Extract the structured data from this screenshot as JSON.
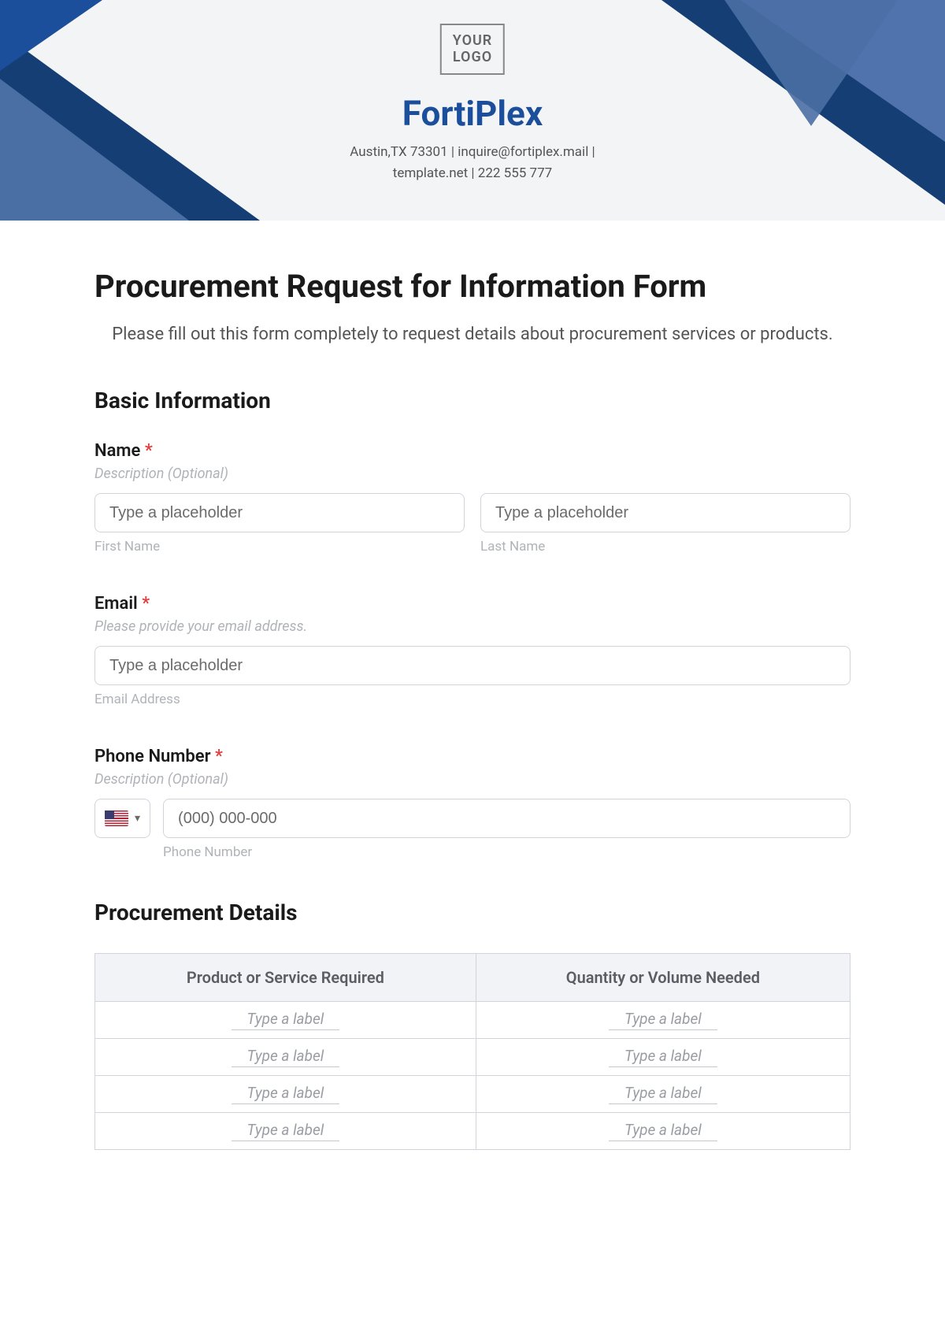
{
  "header": {
    "logo_text_line1": "YOUR",
    "logo_text_line2": "LOGO",
    "company_name": "FortiPlex",
    "info_line1": "Austin,TX 73301 | inquire@fortiplex.mail |",
    "info_line2": "template.net | 222 555 777"
  },
  "page": {
    "title": "Procurement Request for Information Form",
    "intro": "Please fill out this form completely to request details about procurement services or products."
  },
  "sections": {
    "basic_info_heading": "Basic Information",
    "procurement_details_heading": "Procurement Details"
  },
  "fields": {
    "name": {
      "label": "Name",
      "required_mark": "*",
      "description": "Description (Optional)",
      "first_placeholder": "Type a placeholder",
      "first_sublabel": "First Name",
      "last_placeholder": "Type a placeholder",
      "last_sublabel": "Last Name"
    },
    "email": {
      "label": "Email",
      "required_mark": "*",
      "description": "Please provide your email address.",
      "placeholder": "Type a placeholder",
      "sublabel": "Email Address"
    },
    "phone": {
      "label": "Phone Number",
      "required_mark": "*",
      "description": "Description (Optional)",
      "placeholder": "(000) 000-000",
      "sublabel": "Phone Number"
    }
  },
  "table": {
    "col1": "Product or Service Required",
    "col2": "Quantity or Volume Needed",
    "cell_placeholder": "Type a label",
    "rows": 4
  }
}
